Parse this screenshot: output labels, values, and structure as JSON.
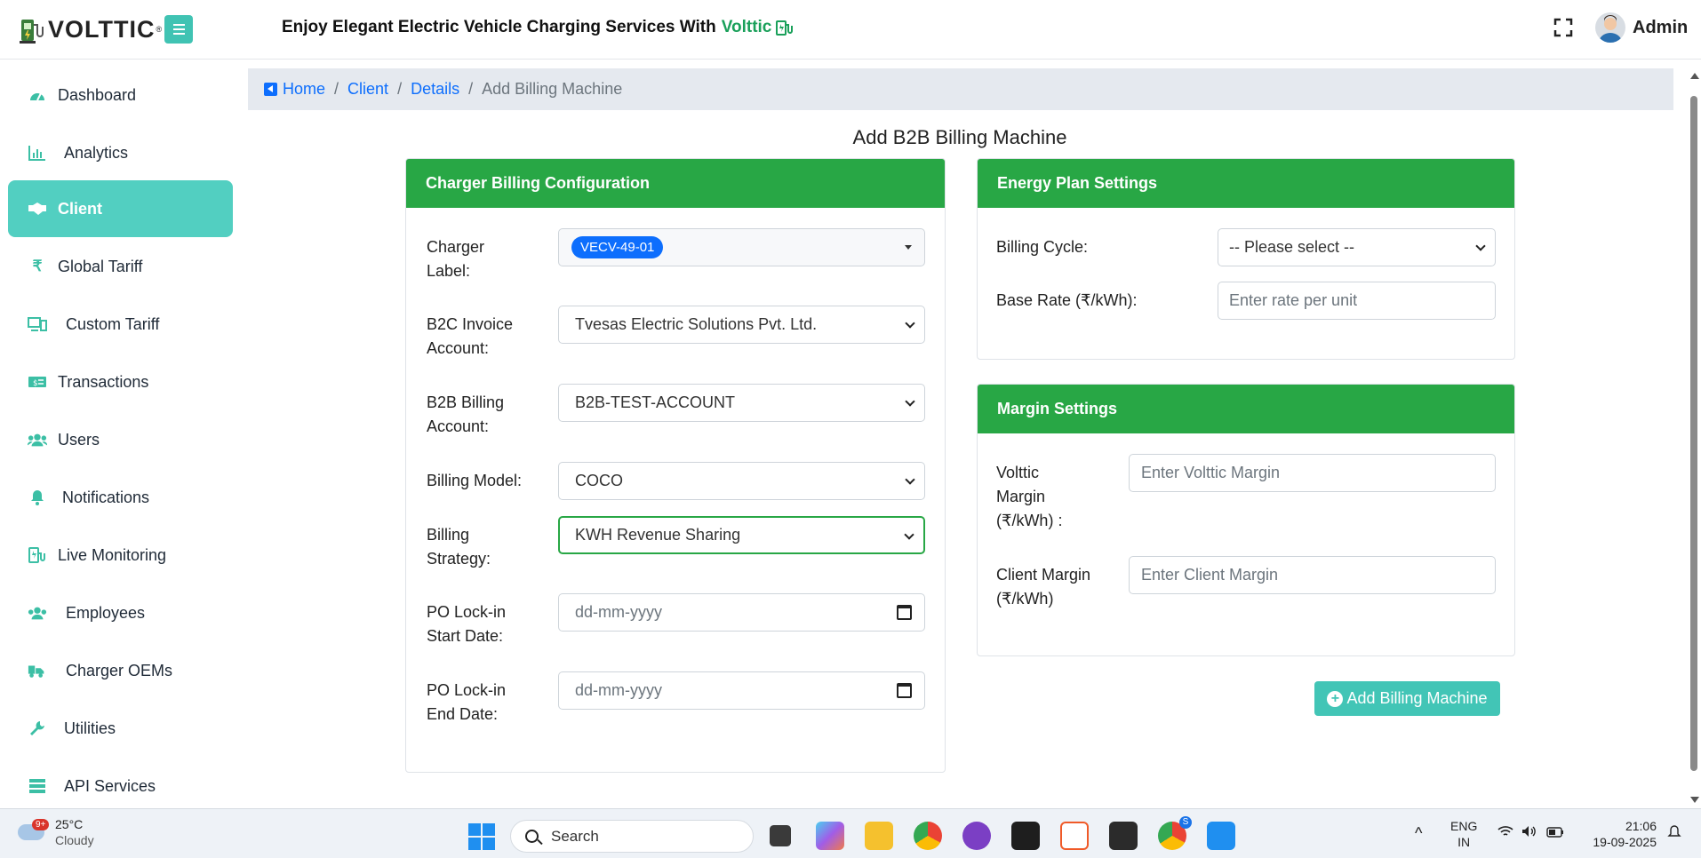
{
  "header": {
    "logo_text": "VOLTTIC",
    "logo_reg": "®",
    "tagline_prefix": "Enjoy Elegant Electric Vehicle Charging Services With",
    "tagline_brand": "Volttic",
    "user": "Admin"
  },
  "sidebar": {
    "items": [
      {
        "label": "Dashboard",
        "icon": "dashboard-icon"
      },
      {
        "label": "Analytics",
        "icon": "analytics-icon"
      },
      {
        "label": "Client",
        "icon": "handshake-icon",
        "active": true
      },
      {
        "label": "Global Tariff",
        "icon": "rupee-icon"
      },
      {
        "label": "Custom Tariff",
        "icon": "custom-tariff-icon"
      },
      {
        "label": "Transactions",
        "icon": "money-icon"
      },
      {
        "label": "Users",
        "icon": "users-icon"
      },
      {
        "label": "Notifications",
        "icon": "bell-icon"
      },
      {
        "label": "Live Monitoring",
        "icon": "ev-charger-icon"
      },
      {
        "label": "Employees",
        "icon": "employees-icon"
      },
      {
        "label": "Charger OEMs",
        "icon": "truck-icon"
      },
      {
        "label": "Utilities",
        "icon": "wrench-icon"
      },
      {
        "label": "API Services",
        "icon": "server-icon"
      }
    ]
  },
  "breadcrumb": {
    "home": "Home",
    "client": "Client",
    "details": "Details",
    "current": "Add Billing Machine"
  },
  "page_title": "Add B2B Billing Machine",
  "charger_card": {
    "title": "Charger Billing Configuration",
    "charger_label": "Charger Label:",
    "charger_value": "VECV-49-01",
    "b2c_label": "B2C Invoice Account:",
    "b2c_value": "Tvesas Electric Solutions Pvt. Ltd.",
    "b2b_label": "B2B Billing Account:",
    "b2b_value": "B2B-TEST-ACCOUNT",
    "model_label": "Billing Model:",
    "model_value": "COCO",
    "strategy_label": "Billing Strategy:",
    "strategy_value": "KWH Revenue Sharing",
    "po_start_label": "PO Lock-in Start Date:",
    "po_start_placeholder": "dd-mm-yyyy",
    "po_end_label": "PO Lock-in End Date:",
    "po_end_placeholder": "dd-mm-yyyy"
  },
  "energy_card": {
    "title": "Energy Plan Settings",
    "cycle_label": "Billing Cycle:",
    "cycle_value": "-- Please select --",
    "rate_label": "Base Rate (₹/kWh):",
    "rate_placeholder": "Enter rate per unit"
  },
  "margin_card": {
    "title": "Margin Settings",
    "volttic_label": "Volttic Margin (₹/kWh) :",
    "volttic_placeholder": "Enter Volttic Margin",
    "client_label": "Client Margin (₹/kWh)",
    "client_placeholder": "Enter Client Margin"
  },
  "submit_label": "Add Billing Machine",
  "taskbar": {
    "temp": "25°C",
    "condition": "Cloudy",
    "notif_badge": "9+",
    "search": "Search",
    "lang_1": "ENG",
    "lang_2": "IN",
    "time": "21:06",
    "date": "19-09-2025",
    "chrome_badge": "S"
  },
  "colors": {
    "accent": "#52cfc1",
    "card_header": "#28a745",
    "link": "#0d6efd"
  }
}
